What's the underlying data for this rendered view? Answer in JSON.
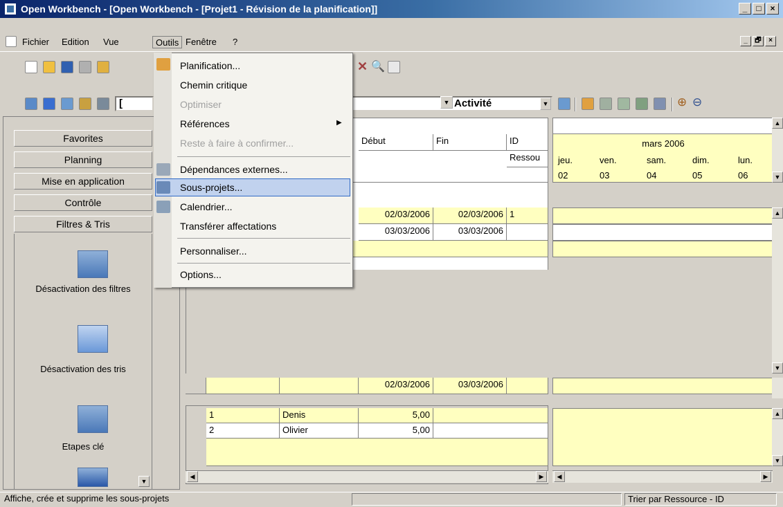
{
  "window": {
    "title": "Open Workbench - [Open Workbench - [Projet1 - Révision de la planification]]",
    "min": "_",
    "max": "□",
    "close": "×",
    "restore": "🗗"
  },
  "menubar": {
    "items": [
      {
        "label": "Fichier"
      },
      {
        "label": "Edition"
      },
      {
        "label": "Vue"
      },
      {
        "label": "Outils"
      },
      {
        "label": "Fenêtre"
      },
      {
        "label": "?"
      }
    ]
  },
  "toolbar": {
    "view_select": "Activité",
    "combo_prefix": "["
  },
  "sidebar": {
    "nav": [
      "Favorites",
      "Planning",
      "Mise en application",
      "Contrôle",
      "Filtres & Tris"
    ],
    "tools": [
      {
        "label": "Désactivation des filtres",
        "icon": "filter-off-icon"
      },
      {
        "label": "Désactivation des tris",
        "icon": "sort-off-icon"
      },
      {
        "label": "Etapes clé",
        "icon": "milestones-icon"
      }
    ]
  },
  "outils_menu": {
    "items": [
      {
        "label": "Planification...",
        "enabled": true
      },
      {
        "label": "Chemin critique",
        "enabled": true
      },
      {
        "label": "Optimiser",
        "enabled": false
      },
      {
        "label": "Références",
        "enabled": true,
        "submenu": "▶"
      },
      {
        "label": "Reste à faire à confirmer...",
        "enabled": false
      },
      {
        "label": "Dépendances externes...",
        "enabled": true
      },
      {
        "label": "Sous-projets...",
        "enabled": true,
        "highlighted": true
      },
      {
        "label": "Calendrier...",
        "enabled": true
      },
      {
        "label": "Transférer affectations",
        "enabled": true
      },
      {
        "label": "Personnaliser...",
        "enabled": true
      },
      {
        "label": "Options...",
        "enabled": true
      }
    ]
  },
  "task_grid": {
    "headers": [
      "Début",
      "Fin",
      "ID",
      "Ressou"
    ],
    "rows": [
      {
        "begin": "02/03/2006",
        "end": "02/03/2006",
        "id": "1"
      },
      {
        "begin": "03/03/2006",
        "end": "03/03/2006",
        "id": ""
      }
    ],
    "totals": {
      "begin": "02/03/2006",
      "end": "03/03/2006"
    }
  },
  "gantt": {
    "month": "mars 2006",
    "days": [
      {
        "name": "jeu.",
        "num": "02"
      },
      {
        "name": "ven.",
        "num": "03"
      },
      {
        "name": "sam.",
        "num": "04"
      },
      {
        "name": "dim.",
        "num": "05"
      },
      {
        "name": "lun.",
        "num": "06"
      }
    ]
  },
  "resource_grid": {
    "rows": [
      {
        "id": "1",
        "name": "Denis",
        "value": "5,00"
      },
      {
        "id": "2",
        "name": "Olivier",
        "value": "5,00"
      }
    ]
  },
  "statusbar": {
    "message": "Affiche, crée et supprime les sous-projets",
    "sort": "Trier par Ressource - ID"
  },
  "colors": {
    "title_start": "#0a246a",
    "grid_yellow": "#ffffc0",
    "highlight": "#c1d2ee"
  }
}
